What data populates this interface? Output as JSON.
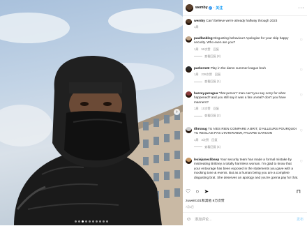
{
  "header": {
    "username": "wemby",
    "verified_mark": "✓",
    "follow_label": "关注",
    "more_label": "···"
  },
  "caption": {
    "username": "wemby",
    "text": "Can't believe we're already halfway through 2023",
    "time": "1周"
  },
  "comments": [
    {
      "username": "paulfanblog",
      "text": "Disgusting behaviour! Apologise for your skip happy security. Who even are you?",
      "time": "1周",
      "likes": "59次赞",
      "reply": "回复",
      "view_replies": "查看回复 (8)"
    },
    {
      "username": "parkern22",
      "text": "Play in the damn summer league bruh",
      "time": "1周",
      "likes": "238次赞",
      "reply": "回复",
      "view_replies": "查看回复 (1)"
    },
    {
      "username": "harvey.peragua",
      "text": "\"that person\" man can't you say sorry for what happened? and you still say it was a fan unreal? don't you have manners?",
      "time": "1周",
      "likes": "10次赞",
      "reply": "回复",
      "view_replies": "查看回复 (2)"
    },
    {
      "username": "tlhrsnug",
      "text": "TU N'ES RIEN COMPARE A BRIT, D'AILLEURS POURQUOI TU REGLAIS PAS L'INTERVIEW, PAUVRE GARCON",
      "time": "1周",
      "likes": "3次赞",
      "reply": "回复",
      "view_replies": "查看回复 (4)"
    },
    {
      "username": "lexiejuneclibsep",
      "text": "Your security team has made a formal mistake by mistreating Brittney a totally harmless woman. I'm glad to know that your entourage has been exposed in the statements you gave with a mocking tone & events. But as a human being you are a complete disgusting brat. She deserves an apology and you're gonna pay for that.",
      "time": "",
      "likes": "",
      "reply": "",
      "view_replies": ""
    }
  ],
  "actions": {
    "like_icon": "heart-outline-icon",
    "comment_icon": "comment-icon",
    "share_icon": "send-icon",
    "save_icon": "bookmark-icon"
  },
  "likes_text": "zuwei0101和其他 8万次赞",
  "date": "7月1日",
  "add_comment": {
    "placeholder": "添加评论...",
    "post_label": "发布",
    "emoji_icon": "smile-icon"
  }
}
